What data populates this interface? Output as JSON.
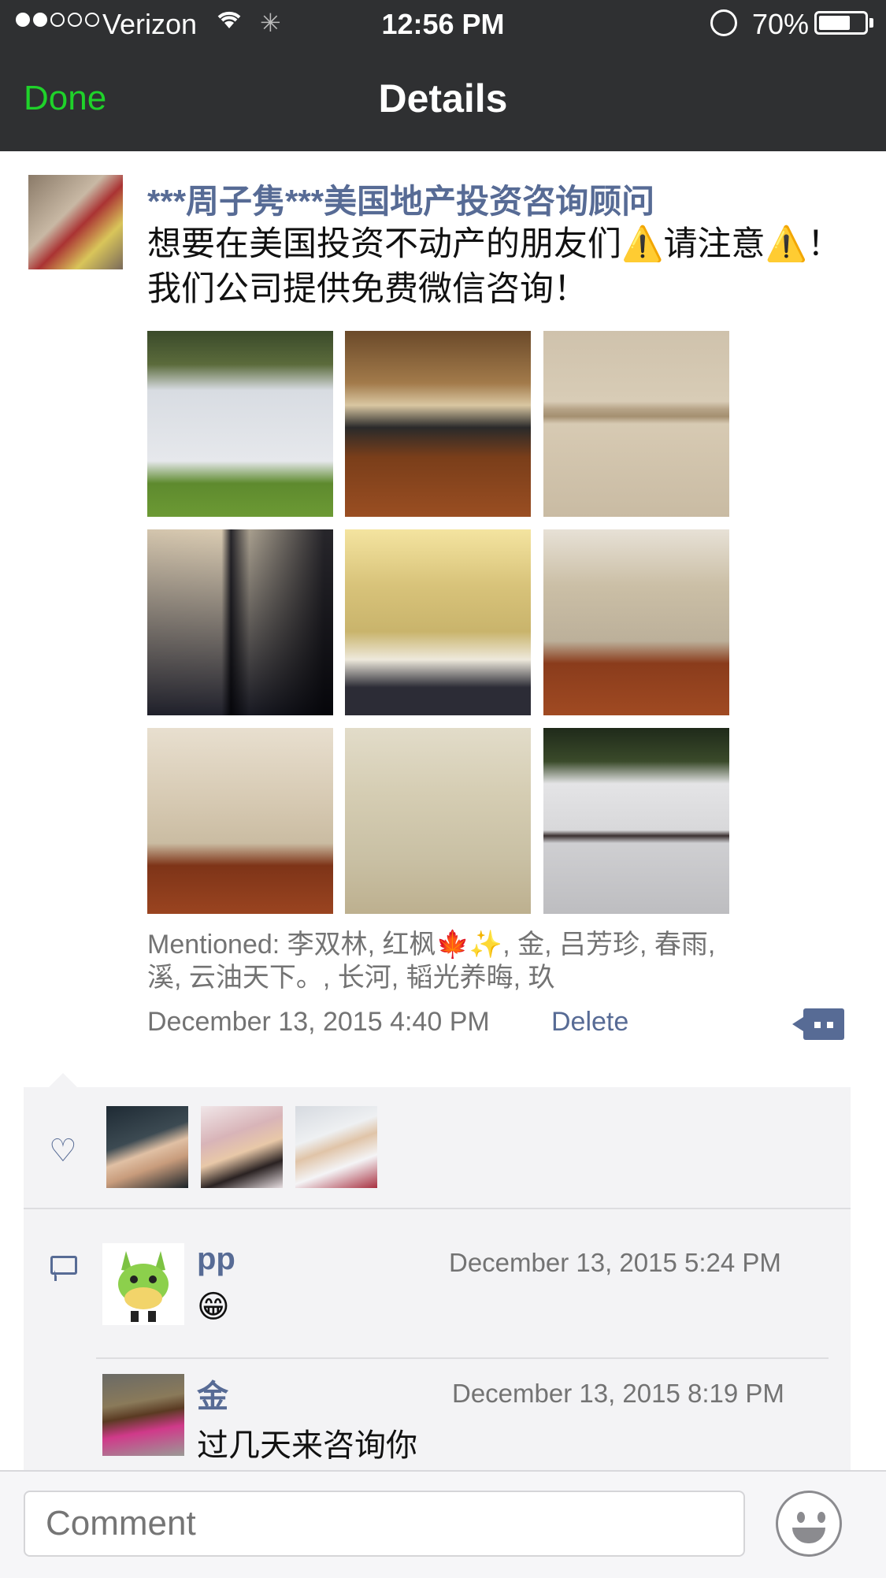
{
  "status_bar": {
    "carrier": "Verizon",
    "time": "12:56 PM",
    "battery_percent": "70%",
    "battery_level": 0.7,
    "signal_bars_filled": 2,
    "signal_bars_total": 5
  },
  "nav": {
    "done_label": "Done",
    "title": "Details"
  },
  "post": {
    "author": "***周子隽***美国地产投资咨询顾问",
    "text": "想要在美国投资不动产的朋友们⚠️请注意⚠️！我们公司提供免费微信咨询！",
    "photos": [
      {
        "icon": "house-exterior-photo"
      },
      {
        "icon": "kitchen-photo"
      },
      {
        "icon": "shower-tile-photo"
      },
      {
        "icon": "bathroom-vanity-photo"
      },
      {
        "icon": "bathroom-sink-photo"
      },
      {
        "icon": "living-room-photo"
      },
      {
        "icon": "dining-room-photo"
      },
      {
        "icon": "empty-room-photo"
      },
      {
        "icon": "garage-photo"
      }
    ],
    "mentioned": "Mentioned: 李双林, 红枫🍁✨, 金, 吕芳珍, 春雨, 溪, 云油天下。, 长河, 韬光养晦, 玖",
    "date": "December 13, 2015 4:40 PM",
    "delete_label": "Delete"
  },
  "likes": {
    "icon": "heart-icon",
    "count_avatars": 3
  },
  "comments": [
    {
      "name": "pp",
      "date": "December 13, 2015 5:24 PM",
      "text": "😁"
    },
    {
      "name": "金",
      "date": "December 13, 2015 8:19 PM",
      "text": "过几天来咨询你"
    }
  ],
  "comment_bar": {
    "placeholder": "Comment"
  },
  "colors": {
    "nav_bg": "#2f3032",
    "done_green": "#1fd22a",
    "link_blue": "#576b95",
    "panel_bg": "#f3f3f5"
  }
}
